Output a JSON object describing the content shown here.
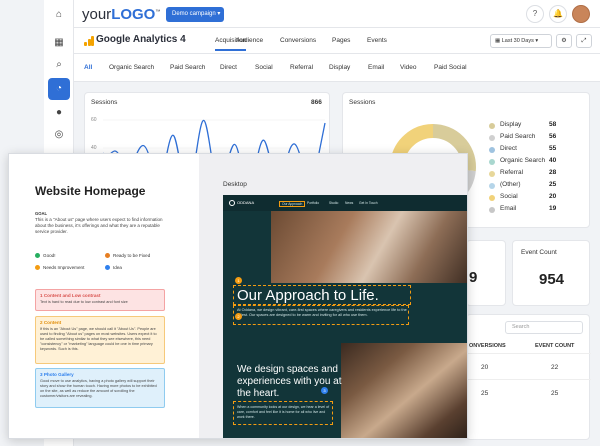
{
  "header": {
    "logo_prefix": "your",
    "logo_brand": "LOGO",
    "logo_tm": "™",
    "demo_label": "Demo campaign",
    "help_label": "?",
    "notif_label": "🔔"
  },
  "ga": {
    "title": "Google Analytics 4",
    "tabs": [
      "Acquisition",
      "Audience",
      "Conversions",
      "Pages",
      "Events"
    ],
    "date_label": "Last 30 Days",
    "btn1": "⚙",
    "btn2": "⤢"
  },
  "channels": [
    "All",
    "Organic Search",
    "Paid Search",
    "Direct",
    "Social",
    "Referral",
    "Display",
    "Email",
    "Video",
    "Paid Social"
  ],
  "sessions_line": {
    "title": "Sessions",
    "total": "866",
    "ticks": [
      "60",
      "40"
    ]
  },
  "sessions_donut": {
    "title": "Sessions",
    "legend": [
      {
        "label": "Display",
        "value": "58",
        "color": "#d8cc9a"
      },
      {
        "label": "Paid Search",
        "value": "56",
        "color": "#d0d0d0"
      },
      {
        "label": "Direct",
        "value": "55",
        "color": "#9fc3e0"
      },
      {
        "label": "Organic Search",
        "value": "40",
        "color": "#a9d7cf"
      },
      {
        "label": "Referral",
        "value": "28",
        "color": "#e7d79a"
      },
      {
        "label": "(Other)",
        "value": "25",
        "color": "#b5d5e9"
      },
      {
        "label": "Social",
        "value": "20",
        "color": "#f1d27a"
      },
      {
        "label": "Email",
        "value": "19",
        "color": "#c7c7c7"
      }
    ]
  },
  "kpi_partial": {
    "value": "9"
  },
  "event_count": {
    "title": "Event Count",
    "value": "954"
  },
  "table": {
    "search_placeholder": "Search",
    "col1": "ONVERSIONS",
    "col2": "EVENT COUNT",
    "rows": [
      [
        "20",
        "22"
      ],
      [
        "25",
        "25"
      ]
    ]
  },
  "doc": {
    "title": "Website Homepage",
    "goal_label": "GOAL",
    "goal_text": "This is a \"About us\" page where users expect to find information about the business, it's offerings and what they are a reputable service provider.",
    "keys": [
      {
        "label": "Good!",
        "color": "#27ae60"
      },
      {
        "label": "Ready to be Fixed",
        "color": "#e67e22"
      },
      {
        "label": "Needs Improvement",
        "color": "#f39c12"
      },
      {
        "label": "Idea",
        "color": "#2f80ed"
      }
    ],
    "notes": [
      {
        "num": "1",
        "title": "Content and Low contrast",
        "body": "Text is hard to read due to low contrast and font size",
        "bg": "#fde3e3",
        "border": "#f4a3a3",
        "color": "#d9534f"
      },
      {
        "num": "2",
        "title": "Content",
        "body": "If this is an \"About Us\" page, we should call it \"About Us\". People are used to finding \"About us\" pages on most websites. Users expect it to be called something similar to what they see elsewhere, this need \"consistency\" or \"marketing\" language could be one in time primary keywords. Such is this.",
        "bg": "#fff1d6",
        "border": "#f6c97a",
        "color": "#e08e0b"
      },
      {
        "num": "3",
        "title": "Photo Gallery",
        "body": "Good move to use analytics, having a photo gallery will support their story and show the human touch. Having more photos to be exhibited on the site, as well as reduce the amount of scrolling the customer/visitors are revealing.",
        "bg": "#dff0fb",
        "border": "#8fcbef",
        "color": "#2f80ed"
      }
    ],
    "desktop_label": "Desktop"
  },
  "site": {
    "logo_text": "ODDANA",
    "nav": [
      "Our Approach",
      "Portfolio",
      "Studio",
      "News",
      "Get In Touch"
    ],
    "hero_heading": "Our Approach to Life.",
    "hero_text": "At Oddana, we design vibrant, care-first spaces where caregivers and residents experience life to the fullest. Our spaces are designed to be warm and inviting for all who use them.",
    "sub_heading": "We design spaces and experiences with you at the heart.",
    "sub_text": "When a community looks at our design, we hear a level of care, comfort and feel like it is home for all who live and work there."
  },
  "colors": {
    "accent": "#2f6fd6",
    "ga_orange": "#f4a300",
    "site_bg": "#123539",
    "pin": "#f39c12"
  }
}
